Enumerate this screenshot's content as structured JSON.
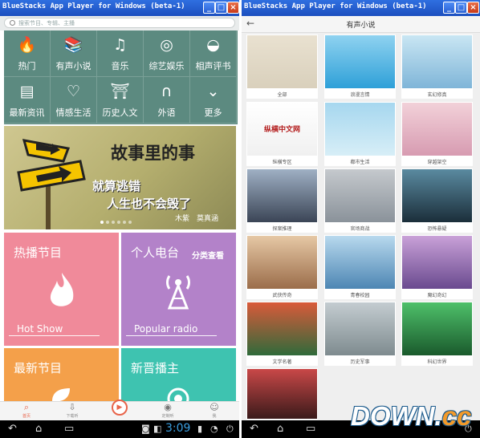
{
  "left_window": {
    "title": "BlueStacks App Player for Windows (beta-1)",
    "search_placeholder": "搜索节目、专辑、主播",
    "categories": [
      {
        "label": "热门",
        "icon": "flame-icon",
        "glyph": "🔥"
      },
      {
        "label": "有声小说",
        "icon": "book-icon",
        "glyph": "📚"
      },
      {
        "label": "音乐",
        "icon": "music-note-icon",
        "glyph": "♫"
      },
      {
        "label": "综艺娱乐",
        "icon": "film-reel-icon",
        "glyph": "◎"
      },
      {
        "label": "相声评书",
        "icon": "fan-icon",
        "glyph": "◒"
      },
      {
        "label": "最新资讯",
        "icon": "newspaper-icon",
        "glyph": "▤"
      },
      {
        "label": "情感生活",
        "icon": "heart-hands-icon",
        "glyph": "♡"
      },
      {
        "label": "历史人文",
        "icon": "temple-icon",
        "glyph": "⛩"
      },
      {
        "label": "外语",
        "icon": "headphones-icon",
        "glyph": "∩"
      },
      {
        "label": "更多",
        "icon": "chevron-down-icon",
        "glyph": "⌄"
      }
    ],
    "banner": {
      "title": "故事里的事",
      "line1": "就算逃错",
      "line2": "人生也不会毁了",
      "credit": "木紫　莫真涵",
      "dots": 6,
      "active_dot": 0
    },
    "tiles": [
      {
        "title": "热播节目",
        "subtitle": "Hot Show",
        "color": "#f08a9a",
        "icon": "flame-icon"
      },
      {
        "title": "个人电台",
        "tag": "分类查看",
        "subtitle": "Popular radio",
        "color": "#b382c9",
        "icon": "radio-tower-icon"
      },
      {
        "title": "最新节目",
        "color": "#f4a04a",
        "icon": "leaf-icon"
      },
      {
        "title": "新晋播主",
        "color": "#3ec3b0",
        "icon": "podcast-icon"
      }
    ],
    "bottom_nav": [
      {
        "label": "首页",
        "icon": "search-icon",
        "glyph": "⌕",
        "active": true
      },
      {
        "label": "下载听",
        "icon": "download-icon",
        "glyph": "⇩"
      },
      {
        "label": "定制听",
        "icon": "broadcast-icon",
        "glyph": "◉"
      },
      {
        "label": "我",
        "icon": "person-icon",
        "glyph": "☺"
      }
    ],
    "clock": "3:09"
  },
  "right_window": {
    "title": "BlueStacks App Player for Windows (beta-1)",
    "header_title": "有声小说",
    "items": [
      {
        "label": "全部",
        "bg": "linear-gradient(#e9e1d0,#d9d0bc)",
        "overlay": ""
      },
      {
        "label": "浪漫言情",
        "bg": "linear-gradient(#8fd2f0,#2ea0d8)",
        "overlay": ""
      },
      {
        "label": "玄幻修真",
        "bg": "linear-gradient(#c9e6f3,#7fb5d8)",
        "overlay": ""
      },
      {
        "label": "纵横专区",
        "bg": "linear-gradient(#ffffff,#f0f0f0)",
        "overlay": "纵横中文网"
      },
      {
        "label": "都市生活",
        "bg": "linear-gradient(#a6d7ef,#d7eef7)",
        "overlay": ""
      },
      {
        "label": "穿越架空",
        "bg": "linear-gradient(#f2d1d9,#d79bb1)",
        "overlay": ""
      },
      {
        "label": "探案推理",
        "bg": "linear-gradient(#9fb0c4,#3b4556)",
        "overlay": ""
      },
      {
        "label": "官场商战",
        "bg": "linear-gradient(#c5c9cd,#8a929a)",
        "overlay": ""
      },
      {
        "label": "恐怖悬疑",
        "bg": "linear-gradient(#5a8aa0,#1b2e3a)",
        "overlay": ""
      },
      {
        "label": "武侠传奇",
        "bg": "linear-gradient(#e6c8a5,#9b6d4a)",
        "overlay": ""
      },
      {
        "label": "青春校园",
        "bg": "linear-gradient(#b8d9ee,#4d86b3)",
        "overlay": ""
      },
      {
        "label": "魔幻奇幻",
        "bg": "linear-gradient(#c9a1d8,#6a4a8f)",
        "overlay": ""
      },
      {
        "label": "文学名著",
        "bg": "linear-gradient(#d95a3a,#2f6a3a)",
        "overlay": ""
      },
      {
        "label": "历史军事",
        "bg": "linear-gradient(#c4ccd1,#7e8b8f)",
        "overlay": ""
      },
      {
        "label": "科幻世界",
        "bg": "linear-gradient(#4ec06a,#1a5a2c)",
        "overlay": ""
      },
      {
        "label": "",
        "bg": "linear-gradient(#c94848,#3a1a1a)",
        "overlay": ""
      }
    ]
  },
  "watermark": {
    "main": "DOWN.",
    "accent": "cc"
  }
}
